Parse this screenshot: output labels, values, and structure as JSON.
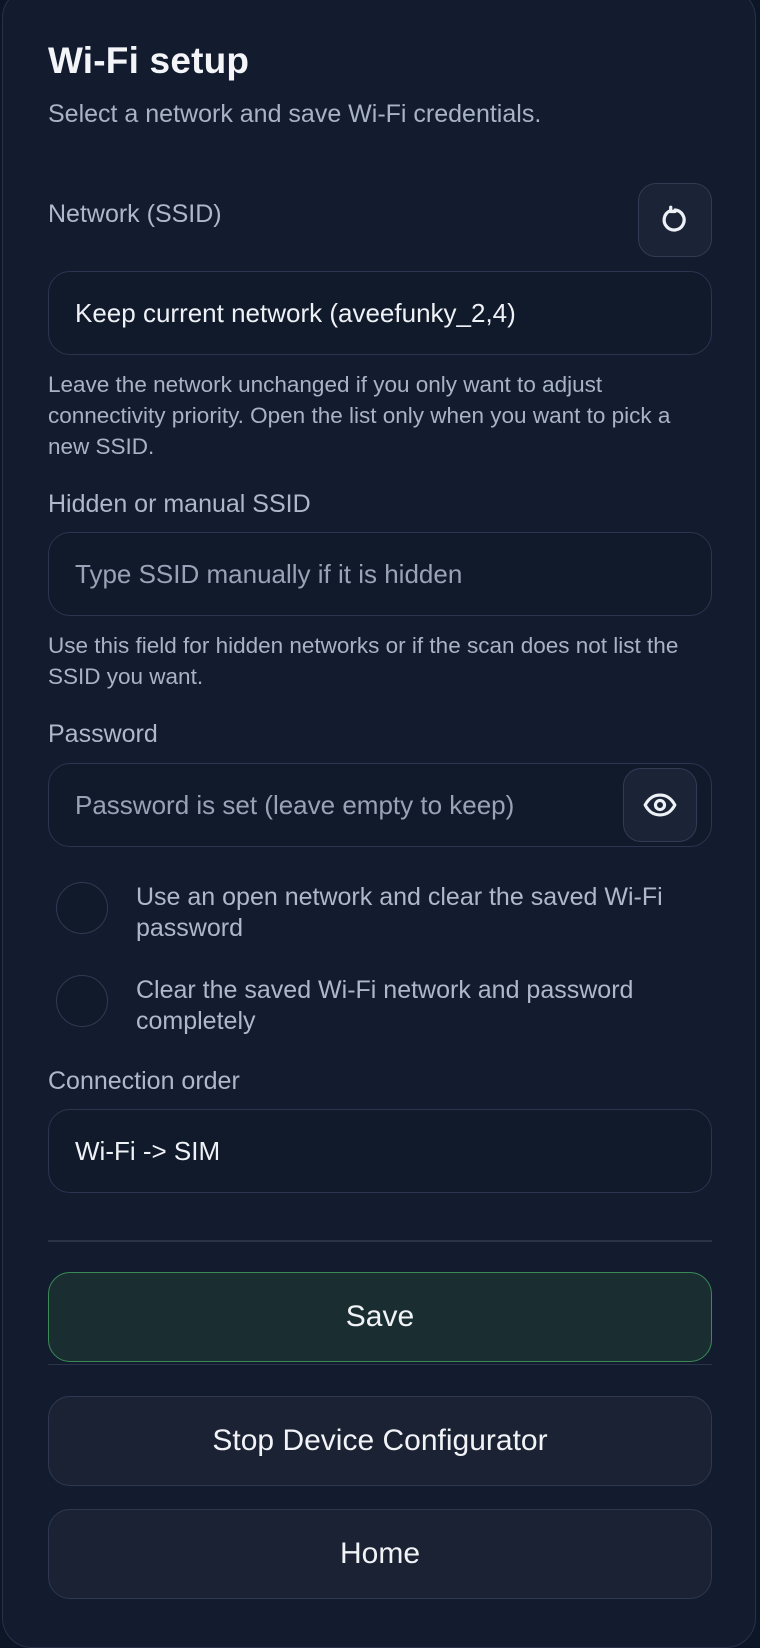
{
  "header": {
    "title": "Wi-Fi setup",
    "subtitle": "Select a network and save Wi-Fi credentials."
  },
  "network": {
    "label": "Network (SSID)",
    "refresh_icon": "refresh-icon",
    "selected_value": "Keep current network (aveefunky_2,4)",
    "help": "Leave the network unchanged if you only want to adjust connectivity priority. Open the list only when you want to pick a new SSID."
  },
  "manual_ssid": {
    "label": "Hidden or manual SSID",
    "placeholder": "Type SSID manually if it is hidden",
    "value": "",
    "help": "Use this field for hidden networks or if the scan does not list the SSID you want."
  },
  "password": {
    "label": "Password",
    "placeholder": "Password is set (leave empty to keep)",
    "value": "",
    "toggle_icon": "eye-icon"
  },
  "options": [
    {
      "label": "Use an open network and clear the saved Wi-Fi password",
      "checked": false
    },
    {
      "label": "Clear the saved Wi-Fi network and password completely",
      "checked": false
    }
  ],
  "connection_order": {
    "label": "Connection order",
    "selected_value": "Wi-Fi -> SIM"
  },
  "actions": {
    "save_label": "Save",
    "stop_label": "Stop Device Configurator",
    "home_label": "Home"
  },
  "colors": {
    "background": "#131c2e",
    "field_background": "#111a2b",
    "save_border": "#3a8a56",
    "text_primary": "#eef1f6",
    "text_secondary": "#a8b3c7"
  }
}
